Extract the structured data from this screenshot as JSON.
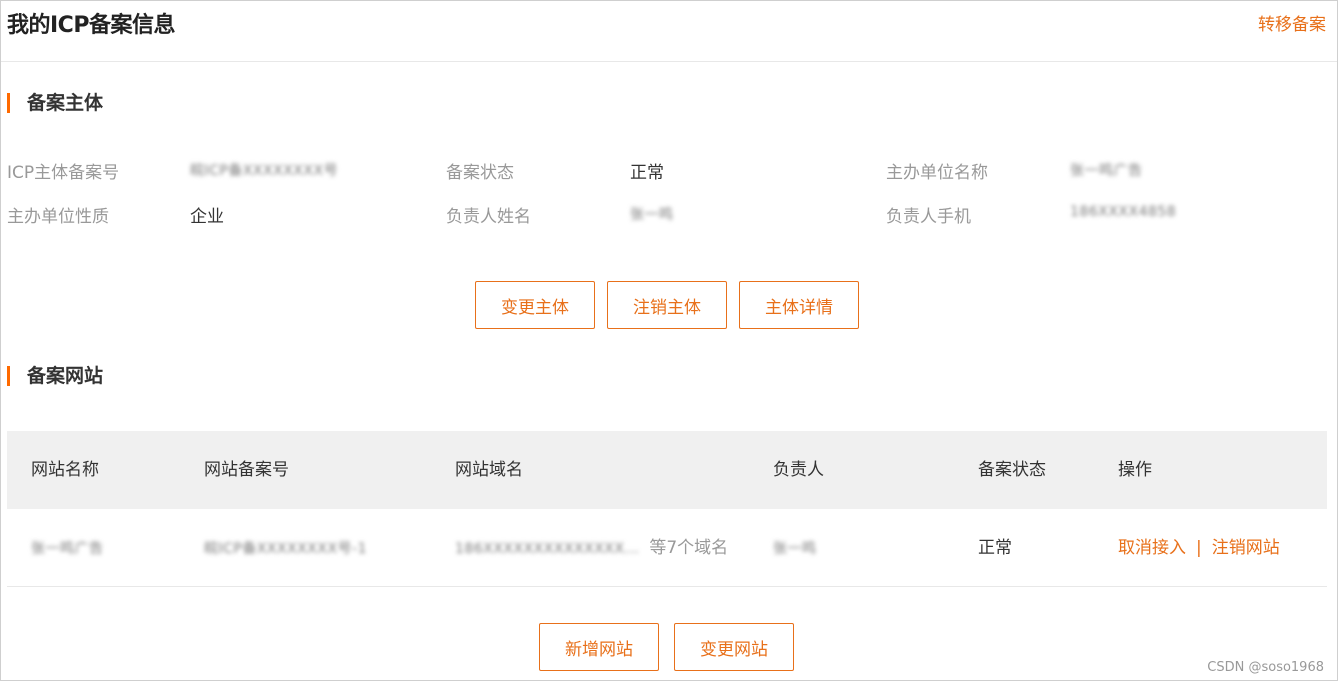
{
  "header": {
    "title": "我的ICP备案信息",
    "transfer_link": "转移备案"
  },
  "entity_section": {
    "title": "备案主体",
    "fields": [
      {
        "label": "ICP主体备案号",
        "value": "皖ICP备XXXXXXXX号"
      },
      {
        "label": "备案状态",
        "value": "正常"
      },
      {
        "label": "主办单位名称",
        "value": "张一鸣广告"
      },
      {
        "label": "主办单位性质",
        "value": "企业"
      },
      {
        "label": "负责人姓名",
        "value": "张一鸣"
      },
      {
        "label": "负责人手机",
        "value": "186XXXX4858"
      }
    ],
    "buttons": {
      "change": "变更主体",
      "cancel": "注销主体",
      "detail": "主体详情"
    }
  },
  "website_section": {
    "title": "备案网站",
    "columns": [
      "网站名称",
      "网站备案号",
      "网站域名",
      "负责人",
      "备案状态",
      "操作"
    ],
    "rows": [
      {
        "name": "张一鸣广告",
        "record_no": "皖ICP备XXXXXXXX号-1",
        "domain": "186XXXXXXXXXXXXXX...",
        "domain_extra": "等7个域名",
        "owner": "张一鸣",
        "status": "正常",
        "actions": [
          "取消接入",
          "注销网站"
        ],
        "action_separator": "|"
      }
    ],
    "buttons": {
      "add": "新增网站",
      "change": "变更网站"
    }
  },
  "watermark": "CSDN @soso1968",
  "colors": {
    "accent": "#e8701a",
    "section_bar": "#ff6a00",
    "table_header_bg": "#f0f0f0"
  }
}
